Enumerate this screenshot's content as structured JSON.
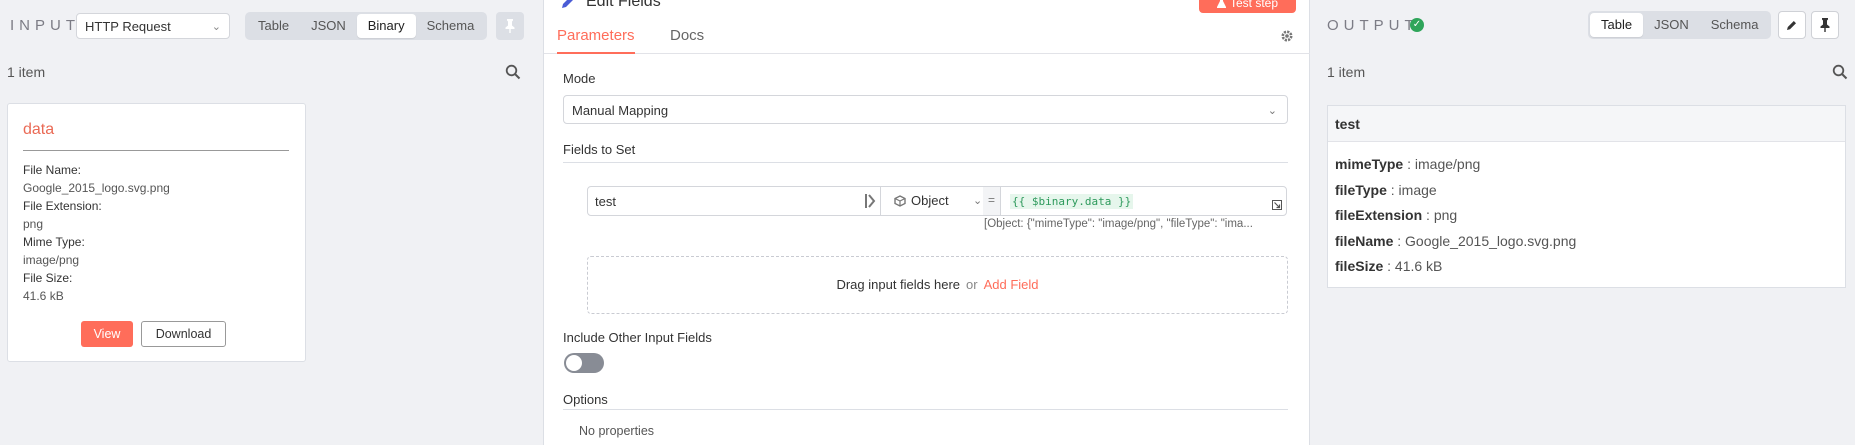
{
  "input": {
    "title": "INPUT",
    "node_select": "HTTP Request",
    "views": [
      "Table",
      "JSON",
      "Binary",
      "Schema"
    ],
    "active_view": "Binary",
    "item_count": "1 item",
    "binary": {
      "name": "data",
      "fields": [
        {
          "label": "File Name:",
          "value": "Google_2015_logo.svg.png"
        },
        {
          "label": "File Extension:",
          "value": "png"
        },
        {
          "label": "Mime Type:",
          "value": "image/png"
        },
        {
          "label": "File Size:",
          "value": "41.6 kB"
        }
      ],
      "view_label": "View",
      "download_label": "Download"
    }
  },
  "node": {
    "title": "Edit Fields",
    "test_step_label": "Test step",
    "tabs": [
      "Parameters",
      "Docs"
    ],
    "active_tab": "Parameters",
    "mode_label": "Mode",
    "mode_value": "Manual Mapping",
    "fields_to_set_label": "Fields to Set",
    "assignment": {
      "name": "test",
      "type": "Object",
      "operator": "=",
      "expression": "{{ $binary.data }}",
      "preview": "[Object: {\"mimeType\": \"image/png\", \"fileType\": \"ima..."
    },
    "drop_text": "Drag input fields here",
    "drop_or": "or",
    "add_field_label": "Add Field",
    "include_other_label": "Include Other Input Fields",
    "include_other_enabled": false,
    "options_label": "Options",
    "no_properties": "No properties"
  },
  "output": {
    "title": "OUTPUT",
    "views": [
      "Table",
      "JSON",
      "Schema"
    ],
    "active_view": "Table",
    "item_count": "1 item",
    "card_title": "test",
    "rows": [
      {
        "key": "mimeType",
        "value": "image/png"
      },
      {
        "key": "fileType",
        "value": "image"
      },
      {
        "key": "fileExtension",
        "value": "png"
      },
      {
        "key": "fileName",
        "value": "Google_2015_logo.svg.png"
      },
      {
        "key": "fileSize",
        "value": "41.6 kB"
      }
    ]
  },
  "colors": {
    "accent": "#ff6d5a",
    "success": "#2fa55a",
    "expression_text": "#2e9a5c"
  },
  "icons": [
    "chevron-down-icon",
    "pin-icon",
    "search-icon",
    "pencil-icon",
    "flask-icon",
    "gear-icon",
    "mapping-icon",
    "cube-icon",
    "expand-icon",
    "check-circle-icon"
  ]
}
